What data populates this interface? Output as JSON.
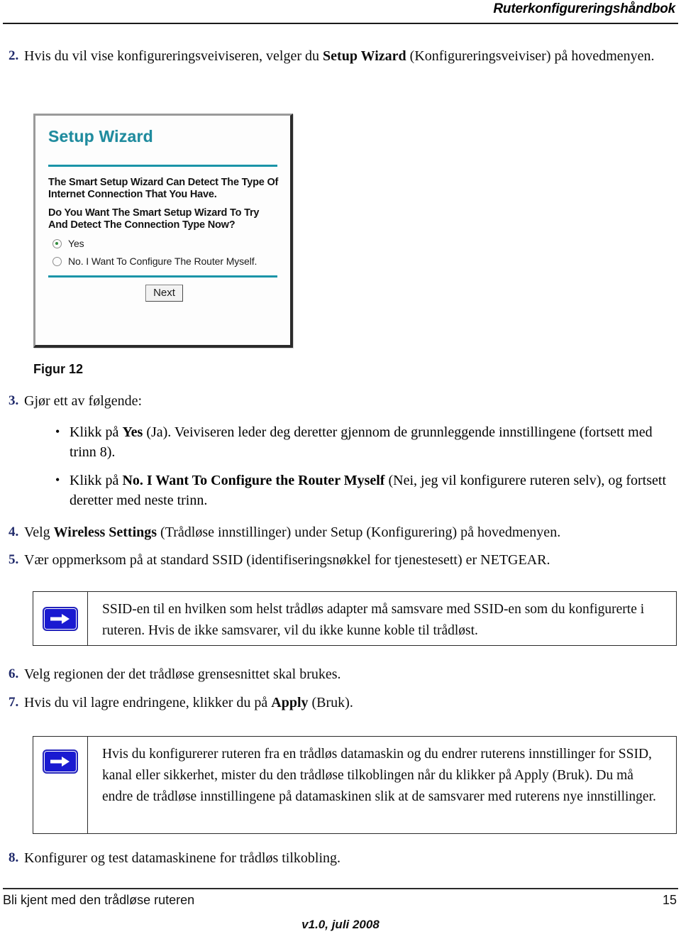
{
  "header": {
    "title": "Ruterkonfigureringshåndbok"
  },
  "steps": {
    "s2": {
      "num": "2.",
      "text_before": "Hvis du vil vise konfigureringsveiviseren, velger du ",
      "bold": "Setup Wizard",
      "text_after": " (Konfigureringsveiviser) på hovedmenyen."
    },
    "s3": {
      "num": "3.",
      "lead": "Gjør ett av følgende:",
      "bullets": [
        {
          "marker": "•",
          "text_before": "Klikk på ",
          "bold": "Yes",
          "text_after": " (Ja). Veiviseren leder deg deretter gjennom de grunnleggende innstillingene (fortsett med trinn 8)."
        },
        {
          "marker": "•",
          "text_before": "Klikk på ",
          "bold": "No. I Want To Configure the Router Myself",
          "text_after": " (Nei, jeg vil konfigurere ruteren selv), og fortsett deretter med neste trinn."
        }
      ]
    },
    "s4": {
      "num": "4.",
      "text_before": "Velg ",
      "bold": "Wireless Settings",
      "text_after": " (Trådløse innstillinger) under Setup (Konfigurering) på hovedmenyen."
    },
    "s5": {
      "num": "5.",
      "text": "Vær oppmerksom på at standard SSID (identifiseringsnøkkel for tjenestesett) er NETGEAR."
    },
    "s6": {
      "num": "6.",
      "text": "Velg regionen der det trådløse grensesnittet skal brukes."
    },
    "s7": {
      "num": "7.",
      "text_before": "Hvis du vil lagre endringene, klikker du på ",
      "bold": "Apply",
      "text_after": " (Bruk)."
    },
    "s8": {
      "num": "8.",
      "text": "Konfigurer og test datamaskinene for trådløs tilkobling."
    }
  },
  "figure": {
    "caption": "Figur 12",
    "wizard": {
      "title": "Setup Wizard",
      "paragraph1": "The Smart Setup Wizard Can Detect The Type Of Internet Connection That You Have.",
      "paragraph2": "Do You Want The Smart Setup Wizard To Try And Detect The Connection Type Now?",
      "options": [
        {
          "label": "Yes",
          "selected": true
        },
        {
          "label": "No. I Want To Configure The Router Myself.",
          "selected": false
        }
      ],
      "next_button": "Next",
      "accent_color": "#1a94a8",
      "title_color": "#1f8b9e",
      "radio_dot_color": "#2f8b3c"
    }
  },
  "notes": [
    {
      "icon": "blue-arrow-note-icon",
      "text": "SSID-en til en hvilken som helst trådløs adapter må samsvare med SSID-en som du konfigurerte i ruteren. Hvis de ikke samsvarer, vil du ikke kunne koble til trådløst."
    },
    {
      "icon": "blue-arrow-note-icon",
      "text": "Hvis du konfigurerer ruteren fra en trådløs datamaskin og du endrer ruterens innstillinger for SSID, kanal eller sikkerhet, mister du den trådløse tilkoblingen når du klikker på Apply (Bruk). Du må endre de trådløse innstillingene på datamaskinen slik at de samsvarer med ruterens nye innstillinger."
    }
  ],
  "footer": {
    "left": "Bli kjent med den trådløse ruteren",
    "page_number": "15",
    "version": "v1.0, juli 2008"
  },
  "colors": {
    "step_number": "#202a6b",
    "note_arrow_blue": "#1a1ad1",
    "rule": "#2b2b2b"
  }
}
